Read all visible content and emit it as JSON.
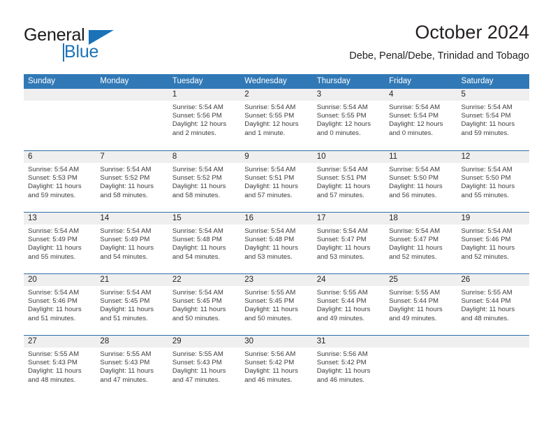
{
  "logo": {
    "word1": "General",
    "word2": "Blue",
    "accent_color": "#1b72b8",
    "triangle_icon": "triangle-icon"
  },
  "header": {
    "title": "October 2024",
    "subtitle": "Debe, Penal/Debe, Trinidad and Tobago"
  },
  "calendar": {
    "header_bg": "#3179b6",
    "daystrip_bg": "#efefef",
    "weekday_names": [
      "Sunday",
      "Monday",
      "Tuesday",
      "Wednesday",
      "Thursday",
      "Friday",
      "Saturday"
    ],
    "weeks": [
      [
        {
          "day": ""
        },
        {
          "day": ""
        },
        {
          "day": "1",
          "sunrise": "Sunrise: 5:54 AM",
          "sunset": "Sunset: 5:56 PM",
          "daylight1": "Daylight: 12 hours",
          "daylight2": "and 2 minutes."
        },
        {
          "day": "2",
          "sunrise": "Sunrise: 5:54 AM",
          "sunset": "Sunset: 5:55 PM",
          "daylight1": "Daylight: 12 hours",
          "daylight2": "and 1 minute."
        },
        {
          "day": "3",
          "sunrise": "Sunrise: 5:54 AM",
          "sunset": "Sunset: 5:55 PM",
          "daylight1": "Daylight: 12 hours",
          "daylight2": "and 0 minutes."
        },
        {
          "day": "4",
          "sunrise": "Sunrise: 5:54 AM",
          "sunset": "Sunset: 5:54 PM",
          "daylight1": "Daylight: 12 hours",
          "daylight2": "and 0 minutes."
        },
        {
          "day": "5",
          "sunrise": "Sunrise: 5:54 AM",
          "sunset": "Sunset: 5:54 PM",
          "daylight1": "Daylight: 11 hours",
          "daylight2": "and 59 minutes."
        }
      ],
      [
        {
          "day": "6",
          "sunrise": "Sunrise: 5:54 AM",
          "sunset": "Sunset: 5:53 PM",
          "daylight1": "Daylight: 11 hours",
          "daylight2": "and 59 minutes."
        },
        {
          "day": "7",
          "sunrise": "Sunrise: 5:54 AM",
          "sunset": "Sunset: 5:52 PM",
          "daylight1": "Daylight: 11 hours",
          "daylight2": "and 58 minutes."
        },
        {
          "day": "8",
          "sunrise": "Sunrise: 5:54 AM",
          "sunset": "Sunset: 5:52 PM",
          "daylight1": "Daylight: 11 hours",
          "daylight2": "and 58 minutes."
        },
        {
          "day": "9",
          "sunrise": "Sunrise: 5:54 AM",
          "sunset": "Sunset: 5:51 PM",
          "daylight1": "Daylight: 11 hours",
          "daylight2": "and 57 minutes."
        },
        {
          "day": "10",
          "sunrise": "Sunrise: 5:54 AM",
          "sunset": "Sunset: 5:51 PM",
          "daylight1": "Daylight: 11 hours",
          "daylight2": "and 57 minutes."
        },
        {
          "day": "11",
          "sunrise": "Sunrise: 5:54 AM",
          "sunset": "Sunset: 5:50 PM",
          "daylight1": "Daylight: 11 hours",
          "daylight2": "and 56 minutes."
        },
        {
          "day": "12",
          "sunrise": "Sunrise: 5:54 AM",
          "sunset": "Sunset: 5:50 PM",
          "daylight1": "Daylight: 11 hours",
          "daylight2": "and 55 minutes."
        }
      ],
      [
        {
          "day": "13",
          "sunrise": "Sunrise: 5:54 AM",
          "sunset": "Sunset: 5:49 PM",
          "daylight1": "Daylight: 11 hours",
          "daylight2": "and 55 minutes."
        },
        {
          "day": "14",
          "sunrise": "Sunrise: 5:54 AM",
          "sunset": "Sunset: 5:49 PM",
          "daylight1": "Daylight: 11 hours",
          "daylight2": "and 54 minutes."
        },
        {
          "day": "15",
          "sunrise": "Sunrise: 5:54 AM",
          "sunset": "Sunset: 5:48 PM",
          "daylight1": "Daylight: 11 hours",
          "daylight2": "and 54 minutes."
        },
        {
          "day": "16",
          "sunrise": "Sunrise: 5:54 AM",
          "sunset": "Sunset: 5:48 PM",
          "daylight1": "Daylight: 11 hours",
          "daylight2": "and 53 minutes."
        },
        {
          "day": "17",
          "sunrise": "Sunrise: 5:54 AM",
          "sunset": "Sunset: 5:47 PM",
          "daylight1": "Daylight: 11 hours",
          "daylight2": "and 53 minutes."
        },
        {
          "day": "18",
          "sunrise": "Sunrise: 5:54 AM",
          "sunset": "Sunset: 5:47 PM",
          "daylight1": "Daylight: 11 hours",
          "daylight2": "and 52 minutes."
        },
        {
          "day": "19",
          "sunrise": "Sunrise: 5:54 AM",
          "sunset": "Sunset: 5:46 PM",
          "daylight1": "Daylight: 11 hours",
          "daylight2": "and 52 minutes."
        }
      ],
      [
        {
          "day": "20",
          "sunrise": "Sunrise: 5:54 AM",
          "sunset": "Sunset: 5:46 PM",
          "daylight1": "Daylight: 11 hours",
          "daylight2": "and 51 minutes."
        },
        {
          "day": "21",
          "sunrise": "Sunrise: 5:54 AM",
          "sunset": "Sunset: 5:45 PM",
          "daylight1": "Daylight: 11 hours",
          "daylight2": "and 51 minutes."
        },
        {
          "day": "22",
          "sunrise": "Sunrise: 5:54 AM",
          "sunset": "Sunset: 5:45 PM",
          "daylight1": "Daylight: 11 hours",
          "daylight2": "and 50 minutes."
        },
        {
          "day": "23",
          "sunrise": "Sunrise: 5:55 AM",
          "sunset": "Sunset: 5:45 PM",
          "daylight1": "Daylight: 11 hours",
          "daylight2": "and 50 minutes."
        },
        {
          "day": "24",
          "sunrise": "Sunrise: 5:55 AM",
          "sunset": "Sunset: 5:44 PM",
          "daylight1": "Daylight: 11 hours",
          "daylight2": "and 49 minutes."
        },
        {
          "day": "25",
          "sunrise": "Sunrise: 5:55 AM",
          "sunset": "Sunset: 5:44 PM",
          "daylight1": "Daylight: 11 hours",
          "daylight2": "and 49 minutes."
        },
        {
          "day": "26",
          "sunrise": "Sunrise: 5:55 AM",
          "sunset": "Sunset: 5:44 PM",
          "daylight1": "Daylight: 11 hours",
          "daylight2": "and 48 minutes."
        }
      ],
      [
        {
          "day": "27",
          "sunrise": "Sunrise: 5:55 AM",
          "sunset": "Sunset: 5:43 PM",
          "daylight1": "Daylight: 11 hours",
          "daylight2": "and 48 minutes."
        },
        {
          "day": "28",
          "sunrise": "Sunrise: 5:55 AM",
          "sunset": "Sunset: 5:43 PM",
          "daylight1": "Daylight: 11 hours",
          "daylight2": "and 47 minutes."
        },
        {
          "day": "29",
          "sunrise": "Sunrise: 5:55 AM",
          "sunset": "Sunset: 5:43 PM",
          "daylight1": "Daylight: 11 hours",
          "daylight2": "and 47 minutes."
        },
        {
          "day": "30",
          "sunrise": "Sunrise: 5:56 AM",
          "sunset": "Sunset: 5:42 PM",
          "daylight1": "Daylight: 11 hours",
          "daylight2": "and 46 minutes."
        },
        {
          "day": "31",
          "sunrise": "Sunrise: 5:56 AM",
          "sunset": "Sunset: 5:42 PM",
          "daylight1": "Daylight: 11 hours",
          "daylight2": "and 46 minutes."
        },
        {
          "day": ""
        },
        {
          "day": ""
        }
      ]
    ]
  }
}
